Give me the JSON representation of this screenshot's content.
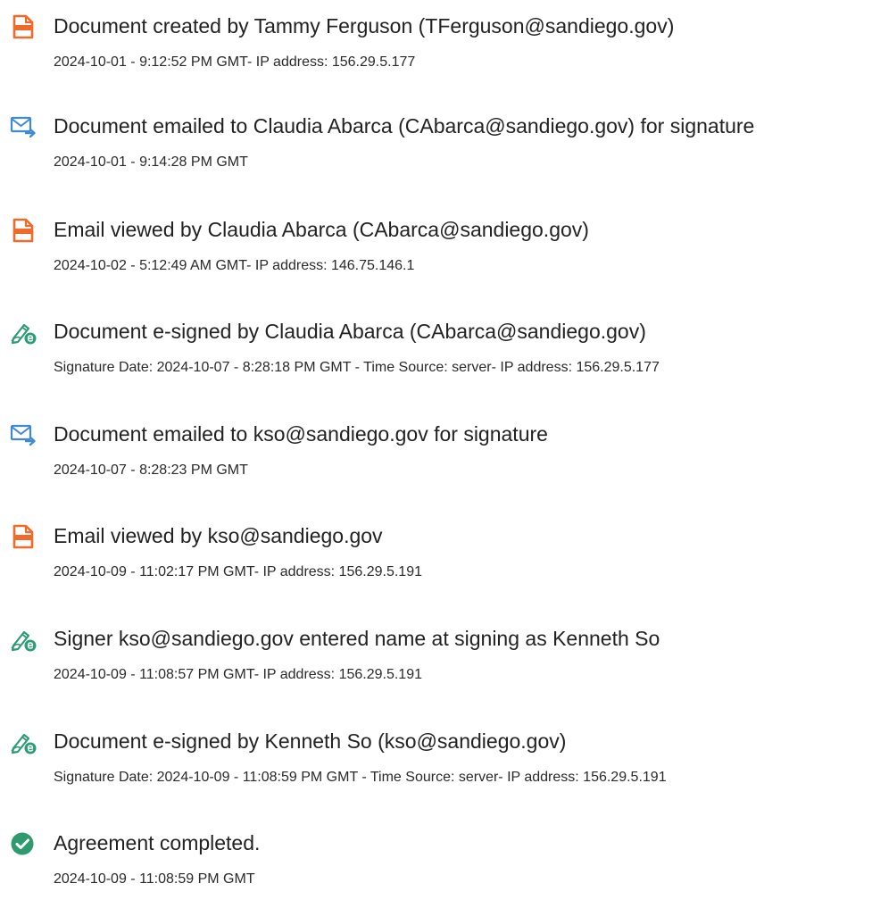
{
  "events": [
    {
      "icon": "document-created-icon",
      "title": "Document created by Tammy Ferguson (TFerguson@sandiego.gov)",
      "detail": "2024-10-01 - 9:12:52 PM GMT- IP address: 156.29.5.177"
    },
    {
      "icon": "email-sent-icon",
      "title": "Document emailed to Claudia Abarca (CAbarca@sandiego.gov) for signature",
      "detail": "2024-10-01 - 9:14:28 PM GMT"
    },
    {
      "icon": "document-viewed-icon",
      "title": "Email viewed by Claudia Abarca (CAbarca@sandiego.gov)",
      "detail": "2024-10-02 - 5:12:49 AM GMT- IP address: 146.75.146.1"
    },
    {
      "icon": "esign-pen-icon",
      "title": "Document e-signed by Claudia Abarca (CAbarca@sandiego.gov)",
      "detail": "Signature Date: 2024-10-07 - 8:28:18 PM GMT - Time Source: server- IP address: 156.29.5.177"
    },
    {
      "icon": "email-sent-icon",
      "title": "Document emailed to kso@sandiego.gov for signature",
      "detail": "2024-10-07 - 8:28:23 PM GMT"
    },
    {
      "icon": "document-viewed-icon",
      "title": "Email viewed by kso@sandiego.gov",
      "detail": "2024-10-09 - 11:02:17 PM GMT- IP address: 156.29.5.191"
    },
    {
      "icon": "esign-pen-icon",
      "title": "Signer kso@sandiego.gov entered name at signing as Kenneth So",
      "detail": "2024-10-09 - 11:08:57 PM GMT- IP address: 156.29.5.191"
    },
    {
      "icon": "esign-pen-icon",
      "title": "Document e-signed by Kenneth So (kso@sandiego.gov)",
      "detail": "Signature Date: 2024-10-09 - 11:08:59 PM GMT - Time Source: server- IP address: 156.29.5.191"
    },
    {
      "icon": "check-circle-icon",
      "title": "Agreement completed.",
      "detail": "2024-10-09 - 11:08:59 PM GMT"
    }
  ],
  "colors": {
    "document_icon": "#f06a2a",
    "email_icon": "#3f8ad6",
    "esign_icon": "#2e9b78",
    "check_icon": "#2d9b6e",
    "text": "#222222"
  }
}
